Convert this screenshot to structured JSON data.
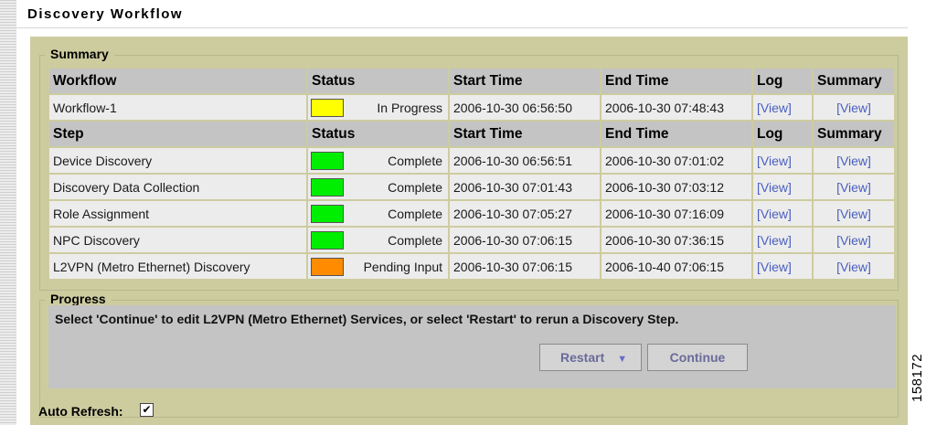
{
  "title": "Discovery Workflow",
  "summary": {
    "legend": "Summary",
    "workflow_header": [
      "Workflow",
      "Status",
      "Start Time",
      "End Time",
      "Log",
      "Summary"
    ],
    "workflow_row": {
      "name": "Workflow-1",
      "status": "In Progress",
      "status_color": "#ffff00",
      "start": "2006-10-30 06:56:50",
      "end": "2006-10-30 07:48:43",
      "log": "[View]",
      "summary": "[View]"
    },
    "step_header": [
      "Step",
      "Status",
      "Start Time",
      "End Time",
      "Log",
      "Summary"
    ],
    "steps": [
      {
        "name": "Device Discovery",
        "status": "Complete",
        "status_color": "#00ee00",
        "start": "2006-10-30 06:56:51",
        "end": "2006-10-30 07:01:02",
        "log": "[View]",
        "summary": "[View]"
      },
      {
        "name": "Discovery Data Collection",
        "status": "Complete",
        "status_color": "#00ee00",
        "start": "2006-10-30 07:01:43",
        "end": "2006-10-30 07:03:12",
        "log": "[View]",
        "summary": "[View]"
      },
      {
        "name": "Role Assignment",
        "status": "Complete",
        "status_color": "#00ee00",
        "start": "2006-10-30 07:05:27",
        "end": "2006-10-30 07:16:09",
        "log": "[View]",
        "summary": "[View]"
      },
      {
        "name": "NPC Discovery",
        "status": "Complete",
        "status_color": "#00ee00",
        "start": "2006-10-30 07:06:15",
        "end": "2006-10-30 07:36:15",
        "log": "[View]",
        "summary": "[View]"
      },
      {
        "name": "L2VPN (Metro Ethernet) Discovery",
        "status": "Pending Input",
        "status_color": "#ff8c00",
        "start": "2006-10-30 07:06:15",
        "end": "2006-10-40 07:06:15",
        "log": "[View]",
        "summary": "[View]"
      }
    ]
  },
  "progress": {
    "legend": "Progress",
    "message": "Select 'Continue' to edit L2VPN (Metro Ethernet) Services, or select 'Restart' to rerun a Discovery Step.",
    "restart_label": "Restart",
    "continue_label": "Continue"
  },
  "auto_refresh": {
    "label": "Auto Refresh:",
    "checked": true,
    "check_glyph": "✔"
  },
  "figure_id": "158172"
}
